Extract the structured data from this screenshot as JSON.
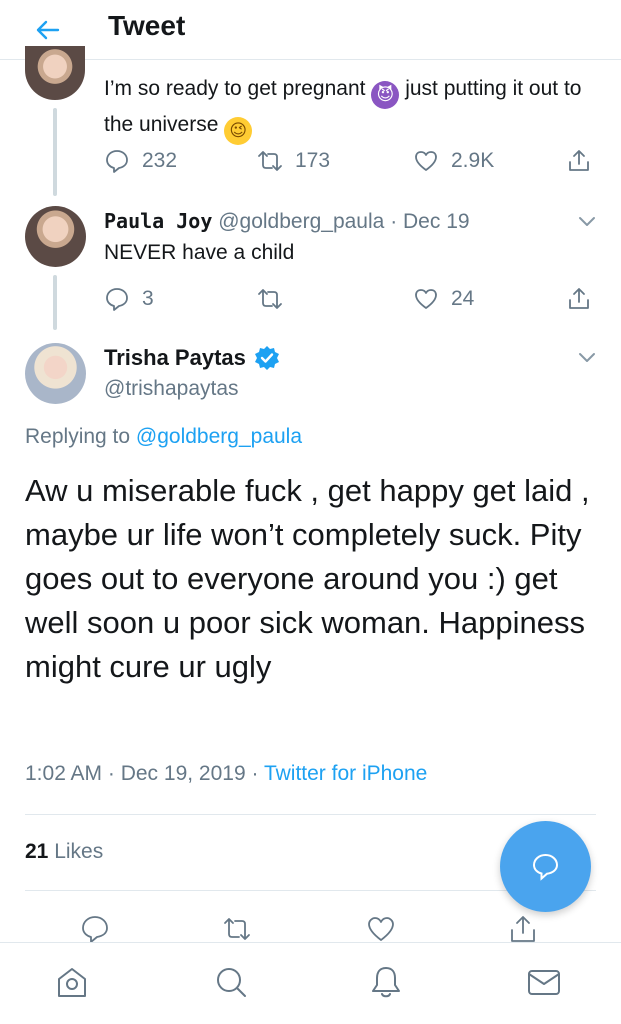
{
  "header": {
    "title": "Tweet"
  },
  "parent_tweet": {
    "text_part1": "I’m so ready to get pregnant",
    "text_part2": "just putting it out to the universe",
    "replies": "232",
    "retweets": "173",
    "likes": "2.9K"
  },
  "reply_tweet": {
    "name": "Paula Joy",
    "handle": "@goldberg_paula",
    "date": "· Dec 19",
    "text": "NEVER have a child",
    "replies": "3",
    "retweets": "",
    "likes": "24"
  },
  "main_tweet": {
    "name": "Trisha Paytas",
    "handle": "@trishapaytas",
    "replying_prefix": "Replying to",
    "replying_handle": "@goldberg_paula",
    "text": "Aw u miserable fuck , get happy get laid , maybe ur life won’t completely suck. Pity goes out to everyone around you :) get well soon u poor sick woman. Happiness might cure ur ugly",
    "timestamp": "1:02 AM · Dec 19, 2019 ·",
    "source": "Twitter for iPhone",
    "likes_count": "21",
    "likes_label": "Likes"
  },
  "icons": {
    "back": "arrow-left-icon",
    "reply": "speech-bubble-icon",
    "retweet": "retweet-icon",
    "like": "heart-icon",
    "share": "share-icon",
    "more": "chevron-down-icon",
    "verified": "verified-badge-icon",
    "compose": "compose-reply-icon",
    "home": "home-icon",
    "search": "search-icon",
    "notifications": "bell-icon",
    "messages": "mail-icon"
  },
  "colors": {
    "accent": "#1da1f2",
    "muted": "#657786",
    "fab": "#4aa4ee"
  }
}
